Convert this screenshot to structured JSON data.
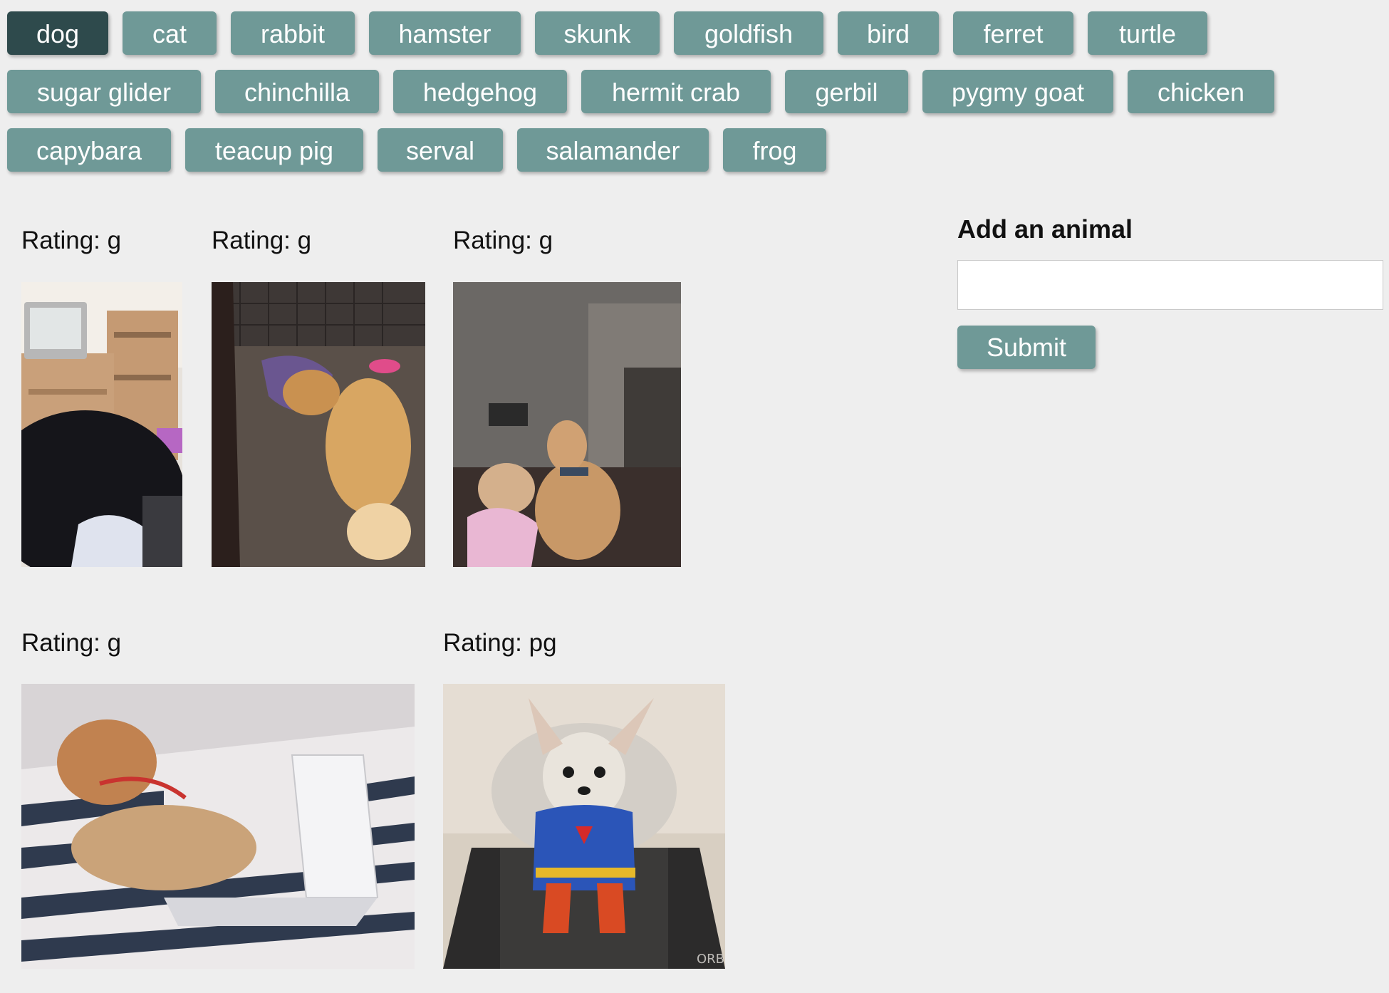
{
  "animals": [
    "dog",
    "cat",
    "rabbit",
    "hamster",
    "skunk",
    "goldfish",
    "bird",
    "ferret",
    "turtle",
    "sugar glider",
    "chinchilla",
    "hedgehog",
    "hermit crab",
    "gerbil",
    "pygmy goat",
    "chicken",
    "capybara",
    "teacup pig",
    "serval",
    "salamander",
    "frog"
  ],
  "selected_animal": "dog",
  "results": [
    {
      "rating": "Rating: g",
      "image": "black puppy in living room with tv and shelves"
    },
    {
      "rating": "Rating: g",
      "image": "golden retriever lying on wood floor"
    },
    {
      "rating": "Rating: g",
      "image": "dog on couch next to woman with phone"
    },
    {
      "rating": "Rating: g",
      "image": "shiba inu in bed with laptop"
    },
    {
      "rating": "Rating: pg",
      "image": "chihuahua in superman costume on treadmill"
    }
  ],
  "form": {
    "title": "Add an animal",
    "input_value": "",
    "submit_label": "Submit"
  },
  "watermark": "ORBO",
  "colors": {
    "button": "#6f9997",
    "button_active": "#2e4a4c",
    "background": "#eeeeee"
  }
}
